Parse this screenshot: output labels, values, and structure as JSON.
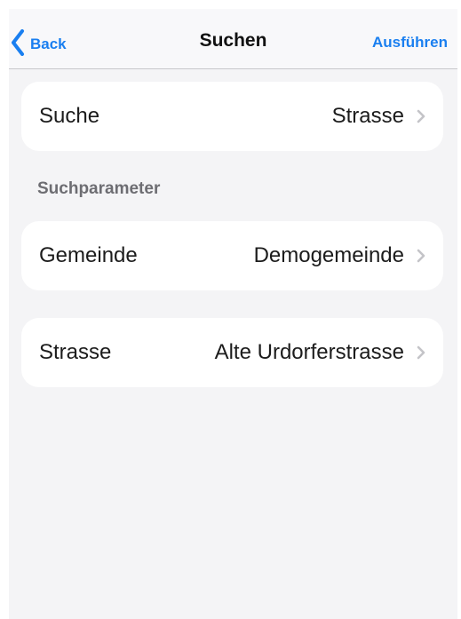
{
  "navbar": {
    "back_label": "Back",
    "title": "Suchen",
    "run_label": "Ausführen"
  },
  "search_cell": {
    "label": "Suche",
    "value": "Strasse"
  },
  "section": {
    "header": "Suchparameter"
  },
  "parameters": [
    {
      "label": "Gemeinde",
      "value": "Demogemeinde"
    },
    {
      "label": "Strasse",
      "value": "Alte Urdorferstrasse"
    }
  ],
  "icons": {
    "back": "chevron-left-icon",
    "disclosure": "chevron-right-icon"
  },
  "colors": {
    "accent": "#1a7ff0",
    "background": "#f4f4f6",
    "cell": "#ffffff",
    "section_header": "#6d6d72",
    "chevron": "#c4c4c8"
  }
}
